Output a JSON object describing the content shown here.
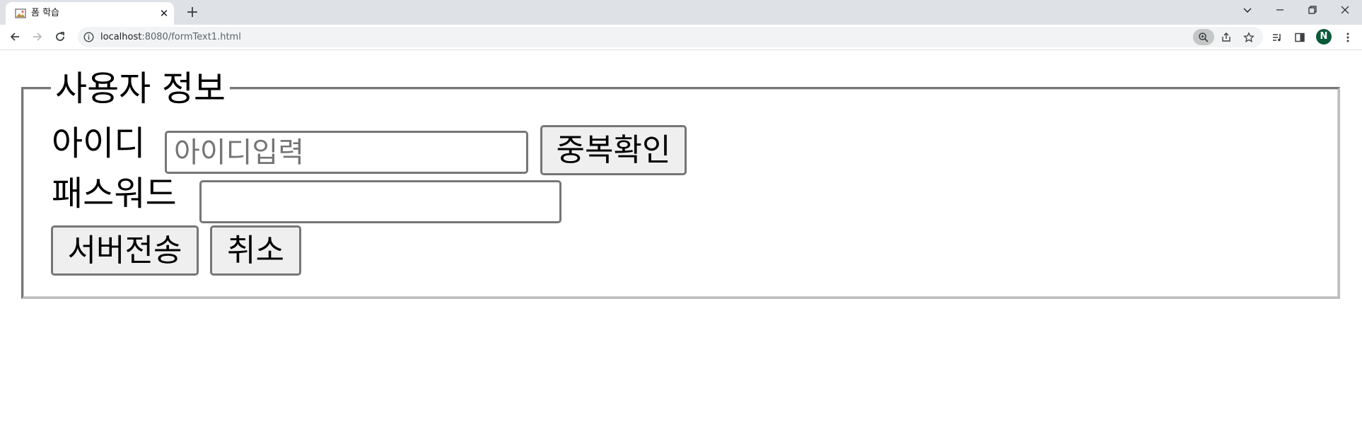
{
  "browser": {
    "tab": {
      "title": "폼 학습",
      "close_glyph": "✕",
      "favicon": "image-icon"
    },
    "new_tab_glyph": "+",
    "url": {
      "host": "localhost",
      "rest": ":8080/formText1.html"
    },
    "profile_initial": "N",
    "icons": [
      "back-arrow-icon",
      "forward-arrow-icon",
      "reload-icon",
      "info-icon",
      "zoom-icon",
      "share-icon",
      "star-icon",
      "reading-list-icon",
      "side-panel-icon",
      "menu-icon",
      "minimize-icon",
      "restore-icon",
      "close-window-icon",
      "tab-search-icon"
    ]
  },
  "form": {
    "legend": "사용자 정보",
    "id": {
      "label": "아이디",
      "placeholder": "아이디입력",
      "value": ""
    },
    "check_button": "중복확인",
    "password": {
      "label": "패스워드",
      "value": ""
    },
    "submit_button": "서버전송",
    "cancel_button": "취소"
  },
  "colors": {
    "tabstrip_bg": "#dee1e6",
    "omnibox_bg": "#f1f3f4",
    "button_bg": "#efefef",
    "border": "#767676",
    "profile_bg": "#0b5a3a"
  }
}
